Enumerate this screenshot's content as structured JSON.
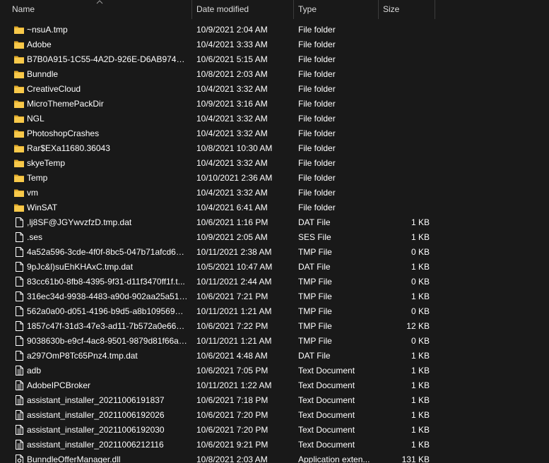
{
  "columns": {
    "name": "Name",
    "date": "Date modified",
    "type": "Type",
    "size": "Size"
  },
  "colors": {
    "background": "#191919",
    "text": "#ffffff",
    "header_text": "#dcdcdc",
    "folder": "#f8c94a",
    "file": "#ffffff"
  },
  "files": [
    {
      "name": "~nsuA.tmp",
      "date": "10/9/2021 2:04 AM",
      "type": "File folder",
      "size": "",
      "icon": "folder-icon"
    },
    {
      "name": "Adobe",
      "date": "10/4/2021 3:33 AM",
      "type": "File folder",
      "size": "",
      "icon": "folder-icon"
    },
    {
      "name": "B7B0A915-1C55-4A2D-926E-D6AB974718...",
      "date": "10/6/2021 5:15 AM",
      "type": "File folder",
      "size": "",
      "icon": "folder-icon"
    },
    {
      "name": "Bunndle",
      "date": "10/8/2021 2:03 AM",
      "type": "File folder",
      "size": "",
      "icon": "folder-icon"
    },
    {
      "name": "CreativeCloud",
      "date": "10/4/2021 3:32 AM",
      "type": "File folder",
      "size": "",
      "icon": "folder-icon"
    },
    {
      "name": "MicroThemePackDir",
      "date": "10/9/2021 3:16 AM",
      "type": "File folder",
      "size": "",
      "icon": "folder-icon"
    },
    {
      "name": "NGL",
      "date": "10/4/2021 3:32 AM",
      "type": "File folder",
      "size": "",
      "icon": "folder-icon"
    },
    {
      "name": "PhotoshopCrashes",
      "date": "10/4/2021 3:32 AM",
      "type": "File folder",
      "size": "",
      "icon": "folder-icon"
    },
    {
      "name": "Rar$EXa11680.36043",
      "date": "10/8/2021 10:30 AM",
      "type": "File folder",
      "size": "",
      "icon": "folder-icon"
    },
    {
      "name": "skyeTemp",
      "date": "10/4/2021 3:32 AM",
      "type": "File folder",
      "size": "",
      "icon": "folder-icon"
    },
    {
      "name": "Temp",
      "date": "10/10/2021 2:36 AM",
      "type": "File folder",
      "size": "",
      "icon": "folder-icon"
    },
    {
      "name": "vm",
      "date": "10/4/2021 3:32 AM",
      "type": "File folder",
      "size": "",
      "icon": "folder-icon"
    },
    {
      "name": "WinSAT",
      "date": "10/4/2021 6:41 AM",
      "type": "File folder",
      "size": "",
      "icon": "folder-icon"
    },
    {
      "name": ",lj8SF@JGYwvzfzD.tmp.dat",
      "date": "10/6/2021 1:16 PM",
      "type": "DAT File",
      "size": "1 KB",
      "icon": "file-icon"
    },
    {
      "name": ".ses",
      "date": "10/9/2021 2:05 AM",
      "type": "SES File",
      "size": "1 KB",
      "icon": "file-icon"
    },
    {
      "name": "4a52a596-3cde-4f0f-8bc5-047b71afcd6c.t...",
      "date": "10/11/2021 2:38 AM",
      "type": "TMP File",
      "size": "0 KB",
      "icon": "file-icon"
    },
    {
      "name": "9pJc&l)suEhKHAxC.tmp.dat",
      "date": "10/5/2021 10:47 AM",
      "type": "DAT File",
      "size": "1 KB",
      "icon": "file-icon"
    },
    {
      "name": "83cc61b0-8fb8-4395-9f31-d11f3470ff1f.t...",
      "date": "10/11/2021 2:44 AM",
      "type": "TMP File",
      "size": "0 KB",
      "icon": "file-icon"
    },
    {
      "name": "316ec34d-9938-4483-a90d-902aa25a5137....",
      "date": "10/6/2021 7:21 PM",
      "type": "TMP File",
      "size": "1 KB",
      "icon": "file-icon"
    },
    {
      "name": "562a0a00-d051-4196-b9d5-a8b109569dc...",
      "date": "10/11/2021 1:21 AM",
      "type": "TMP File",
      "size": "0 KB",
      "icon": "file-icon"
    },
    {
      "name": "1857c47f-31d3-47e3-ad11-7b572a0e66ab....",
      "date": "10/6/2021 7:22 PM",
      "type": "TMP File",
      "size": "12 KB",
      "icon": "file-icon"
    },
    {
      "name": "9038630b-e9cf-4ac8-9501-9879d81f66ac.t...",
      "date": "10/11/2021 1:21 AM",
      "type": "TMP File",
      "size": "0 KB",
      "icon": "file-icon"
    },
    {
      "name": "a297OmP8Tc65Pnz4.tmp.dat",
      "date": "10/6/2021 4:48 AM",
      "type": "DAT File",
      "size": "1 KB",
      "icon": "file-icon"
    },
    {
      "name": "adb",
      "date": "10/6/2021 7:05 PM",
      "type": "Text Document",
      "size": "1 KB",
      "icon": "text-document-icon"
    },
    {
      "name": "AdobeIPCBroker",
      "date": "10/11/2021 1:22 AM",
      "type": "Text Document",
      "size": "1 KB",
      "icon": "text-document-icon"
    },
    {
      "name": "assistant_installer_20211006191837",
      "date": "10/6/2021 7:18 PM",
      "type": "Text Document",
      "size": "1 KB",
      "icon": "text-document-icon"
    },
    {
      "name": "assistant_installer_20211006192026",
      "date": "10/6/2021 7:20 PM",
      "type": "Text Document",
      "size": "1 KB",
      "icon": "text-document-icon"
    },
    {
      "name": "assistant_installer_20211006192030",
      "date": "10/6/2021 7:20 PM",
      "type": "Text Document",
      "size": "1 KB",
      "icon": "text-document-icon"
    },
    {
      "name": "assistant_installer_20211006212116",
      "date": "10/6/2021 9:21 PM",
      "type": "Text Document",
      "size": "1 KB",
      "icon": "text-document-icon"
    },
    {
      "name": "BunndleOfferManager.dll",
      "date": "10/8/2021 2:03 AM",
      "type": "Application exten...",
      "size": "131 KB",
      "icon": "dll-file-icon"
    }
  ]
}
